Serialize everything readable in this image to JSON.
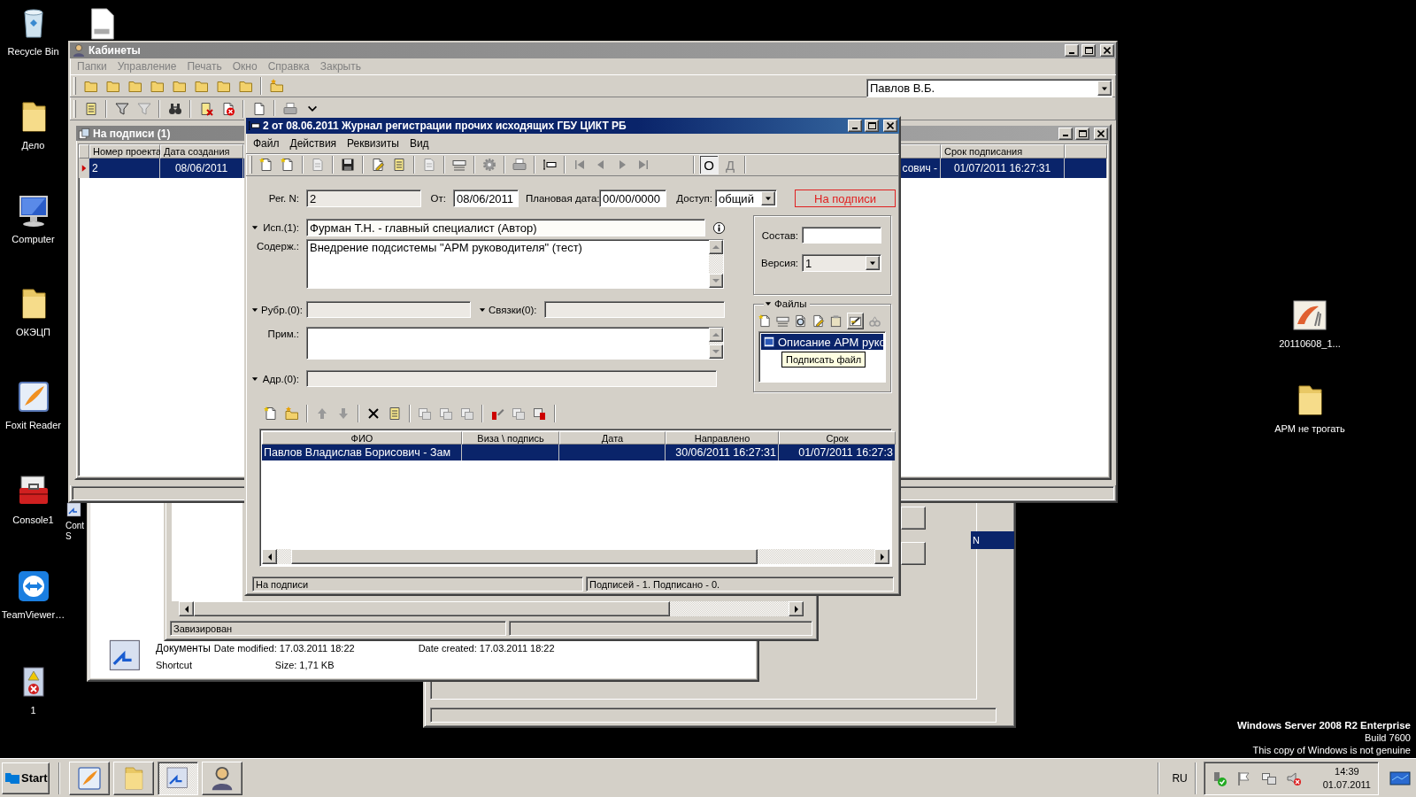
{
  "desktop": {
    "icons_left": [
      {
        "kind": "bin",
        "label": "Recycle Bin"
      },
      {
        "kind": "folder",
        "label": "Дело"
      },
      {
        "kind": "computer",
        "label": "Computer"
      },
      {
        "kind": "folder",
        "label": "ОКЭЦП"
      },
      {
        "kind": "foxit",
        "label": "Foxit Reader"
      },
      {
        "kind": "console",
        "label": "Console1"
      },
      {
        "kind": "teamviewer",
        "label": "TeamViewer…"
      },
      {
        "kind": "warning",
        "label": "1"
      }
    ],
    "icon_partial": {
      "kind": "shortcut",
      "label": "Cont S"
    },
    "icons_right": [
      {
        "kind": "picture",
        "label": "20110608_1..."
      },
      {
        "kind": "folder",
        "label": "АРМ не трогать"
      }
    ],
    "os_notice": [
      "Windows Server 2008 R2 Enterprise",
      "Build 7600",
      "This copy of Windows is not genuine"
    ]
  },
  "background_windows": {
    "explorer_details": {
      "name": "Документы",
      "type": "Shortcut",
      "modified": "Date modified: 17.03.2011 18:22",
      "created": "Date created: 17.03.2011 18:22",
      "size": "Size: 1,71 KB"
    },
    "list_window_status": "Завизирован",
    "third_window_row": "N"
  },
  "main_window": {
    "title": "Кабинеты",
    "menu": [
      "Папки",
      "Управление",
      "Печать",
      "Окно",
      "Справка",
      "Закрыть"
    ],
    "user": "Павлов В.Б.",
    "child": {
      "title": "На подписи (1)",
      "columns": [
        "Номер проекта",
        "Дата создания",
        "Срок подписания"
      ],
      "rows": [
        {
          "selected": true,
          "number": "2",
          "created": "08/06/2011",
          "column_3": "сович -",
          "deadline": "01/07/2011 16:27:31"
        }
      ]
    }
  },
  "dialog": {
    "title": "2 от 08.06.2011 Журнал регистрации прочих исходящих ГБУ ЦИКТ РБ",
    "menu": [
      "Файл",
      "Действия",
      "Реквизиты",
      "Вид"
    ],
    "toggles": [
      {
        "label": "О",
        "selected": true
      },
      {
        "label": "Д",
        "selected": false
      }
    ],
    "reg_n": {
      "label": "Рег. N:",
      "value": "2"
    },
    "from": {
      "label": "От:",
      "value": "08/06/2011"
    },
    "planned": {
      "label": "Плановая дата:",
      "value": "00/00/0000"
    },
    "access": {
      "label": "Доступ:",
      "value": "общий"
    },
    "status_button": "На подписи",
    "executor": {
      "label": "Исп.(1):",
      "value": "Фурман Т.Н. - главный специалист (Автор)"
    },
    "content": {
      "label": "Содерж.:",
      "value": "Внедрение подсистемы \"АРМ руководителя\" (тест)"
    },
    "rubric": {
      "label": "Рубр.(0):"
    },
    "links": {
      "label": "Связки(0):"
    },
    "note": {
      "label": "Прим.:"
    },
    "address": {
      "label": "Адр.(0):"
    },
    "composition": {
      "label": "Состав:"
    },
    "version": {
      "label": "Версия:",
      "value": "1"
    },
    "files": {
      "title": "Файлы",
      "items": [
        {
          "name": "Описание АРМ руко",
          "selected": true
        }
      ],
      "tooltip": "Подписать файл"
    },
    "signers": {
      "columns": [
        "ФИО",
        "Виза \\ подпись",
        "Дата",
        "Направлено",
        "Срок"
      ],
      "rows": [
        {
          "selected": true,
          "fio": "Павлов Владислав Борисович - Зам",
          "sent": "30/06/2011 16:27:31",
          "deadline": "01/07/2011 16:27:3"
        }
      ]
    },
    "status": [
      "На подписи",
      "Подписей - 1.  Подписано - 0."
    ]
  },
  "taskbar": {
    "start": "Start",
    "tasks": [
      {
        "kind": "foxit",
        "selected": false
      },
      {
        "kind": "explorer",
        "selected": false
      },
      {
        "kind": "documents",
        "selected": true
      },
      {
        "kind": "user",
        "selected": false
      }
    ],
    "language": "RU",
    "time": "14:39",
    "date": "01.07.2011"
  }
}
